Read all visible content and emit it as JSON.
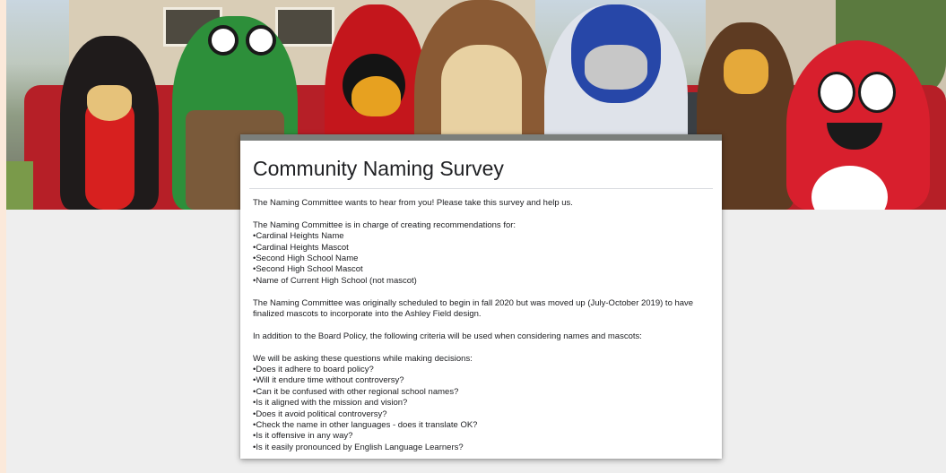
{
  "banner": {
    "image_name": "school-mascots-header-photo"
  },
  "form": {
    "title": "Community Naming Survey",
    "intro": "The Naming Committee wants to hear from you! Please take this survey and help us.",
    "charge_heading": "The Naming Committee is in charge of creating recommendations for:",
    "charge_items": [
      "•Cardinal Heights Name",
      "•Cardinal Heights Mascot",
      "•Second High School Name",
      "•Second High School Mascot",
      "•Name of Current High School (not mascot)"
    ],
    "schedule_line1": "The Naming Committee was originally scheduled to begin in fall 2020 but was moved up (July-October 2019) to have",
    "schedule_line2": "finalized mascots to incorporate into the Ashley Field design.",
    "criteria": "In addition to the Board Policy, the following criteria will be used when considering names and mascots:",
    "questions_heading": "We will be asking these questions while making decisions:",
    "questions": [
      "•Does it adhere to board policy?",
      "•Will it endure time without controversy?",
      "•Can it be confused with other regional school names?",
      "•Is it aligned with the mission and vision?",
      "•Does it avoid political controversy?",
      "•Check the name in other languages - does it translate OK?",
      "•Is it offensive in any way?",
      "•Is it easily pronounced by English Language Learners?"
    ]
  },
  "colors": {
    "page_background": "#eeeeee",
    "outer_background": "#fbe9da",
    "card_accent_strip": "#7b7f7b",
    "text": "#202124"
  }
}
